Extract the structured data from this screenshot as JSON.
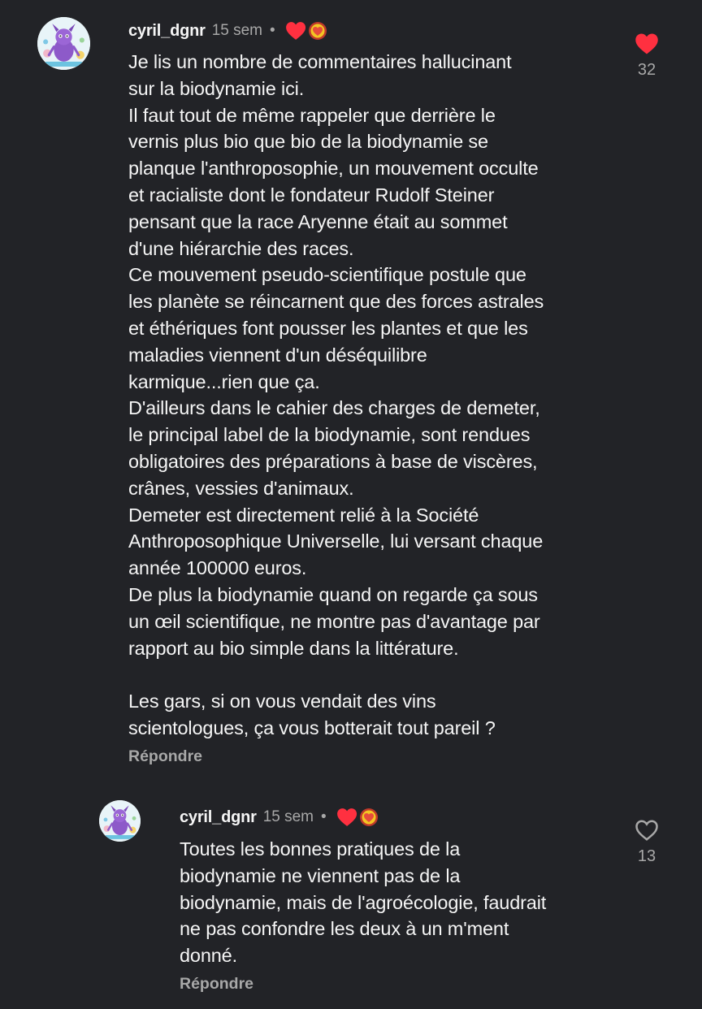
{
  "colors": {
    "background": "#222327",
    "text": "#f5f5f5",
    "muted": "#a8a8a8",
    "like_red": "#ff3040"
  },
  "comments": [
    {
      "username": "cyril_dgnr",
      "time": "15 sem",
      "separator": "•",
      "badges": [
        "red-heart-icon",
        "gold-heart-badge-icon"
      ],
      "text": "Je lis un nombre de commentaires hallucinant\nsur la biodynamie ici.\nIl faut tout de même rappeler que derrière le\nvernis plus bio que bio de la biodynamie se\nplanque l'anthroposophie, un mouvement occulte\net racialiste dont le fondateur Rudolf Steiner\npensant que la race Aryenne était au sommet\nd'une hiérarchie des races.\nCe mouvement pseudo-scientifique postule que\nles planète se réincarnent que des forces astrales\net éthériques font pousser les plantes et que les\nmaladies viennent d'un déséquilibre\nkarmique...rien que ça.\nD'ailleurs dans le cahier des charges de demeter,\nle principal label de la biodynamie, sont rendues\nobligatoires des préparations à base de viscères,\ncrânes, vessies d'animaux.\nDemeter est directement relié à la Société\nAnthroposophique Universelle, lui versant chaque\nannée 100000 euros.\nDe plus la biodynamie quand on regarde ça sous\nun œil scientifique, ne montre pas d'avantage par\nrapport au bio simple dans la littérature.\n\nLes gars, si on vous vendait des vins\nscientologues, ça vous botterait tout pareil ?",
      "reply_label": "Répondre",
      "like_count": "32",
      "liked": true
    },
    {
      "username": "cyril_dgnr",
      "time": "15 sem",
      "separator": "•",
      "badges": [
        "red-heart-icon",
        "gold-heart-badge-icon"
      ],
      "text": "Toutes les bonnes pratiques de la\nbiodynamie ne viennent pas de la\nbiodynamie, mais de l'agroécologie, faudrait\nne pas confondre les deux à un m'ment\ndonné.",
      "reply_label": "Répondre",
      "like_count": "13",
      "liked": false
    }
  ]
}
